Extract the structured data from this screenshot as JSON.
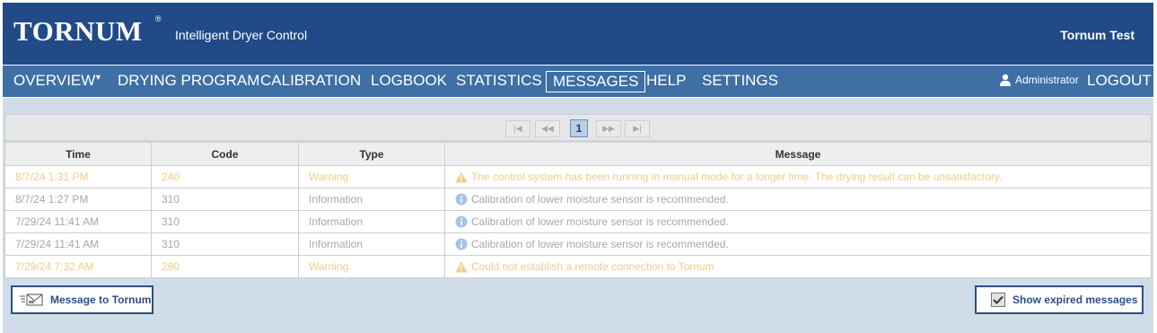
{
  "header": {
    "logo_text": "TORNUM",
    "logo_mark": "®",
    "subtitle": "Intelligent Dryer Control",
    "site_name": "Tornum Test",
    "background": "#214a87"
  },
  "nav": {
    "items": [
      {
        "label": "OVERVIEW"
      },
      {
        "label": "DRYING PROGRAM"
      },
      {
        "label": "CALIBRATION"
      },
      {
        "label": "LOGBOOK"
      },
      {
        "label": "STATISTICS"
      },
      {
        "label": "MESSAGES",
        "active": true
      },
      {
        "label": "HELP"
      },
      {
        "label": "SETTINGS"
      }
    ],
    "user": "Administrator",
    "user_icon": "user-icon",
    "logout": "LOGOUT",
    "background": "#3e6fa5"
  },
  "pager": {
    "first": "|◀",
    "prev": "◀◀",
    "current_page": "1",
    "next": "▶▶",
    "last": "▶|"
  },
  "table": {
    "columns": [
      "Time",
      "Code",
      "Type",
      "Message"
    ],
    "rows": [
      {
        "time": "8/7/24 1:31 PM",
        "code": "240",
        "type": "Warning",
        "icon": "warning-icon",
        "message": "The control system has been running in manual mode for a longer time. The drying result can be unsatisfactory."
      },
      {
        "time": "8/7/24 1:27 PM",
        "code": "310",
        "type": "Information",
        "icon": "info-icon",
        "message": "Calibration of lower moisture sensor is recommended."
      },
      {
        "time": "7/29/24 11:41 AM",
        "code": "310",
        "type": "Information",
        "icon": "info-icon",
        "message": "Calibration of lower moisture sensor is recommended."
      },
      {
        "time": "7/29/24 11:41 AM",
        "code": "310",
        "type": "Information",
        "icon": "info-icon",
        "message": "Calibration of lower moisture sensor is recommended."
      },
      {
        "time": "7/29/24 7:32 AM",
        "code": "290",
        "type": "Warning",
        "icon": "warning-icon",
        "message": "Could not establish a remote connection to Tornum"
      }
    ],
    "warning_color": "#f4cc85",
    "info_color": "#a8a8a8"
  },
  "footer": {
    "message_button": "Message to Tornum",
    "message_icon": "envelope-icon",
    "expired_button": "Show expired messages",
    "expired_checked": true
  }
}
